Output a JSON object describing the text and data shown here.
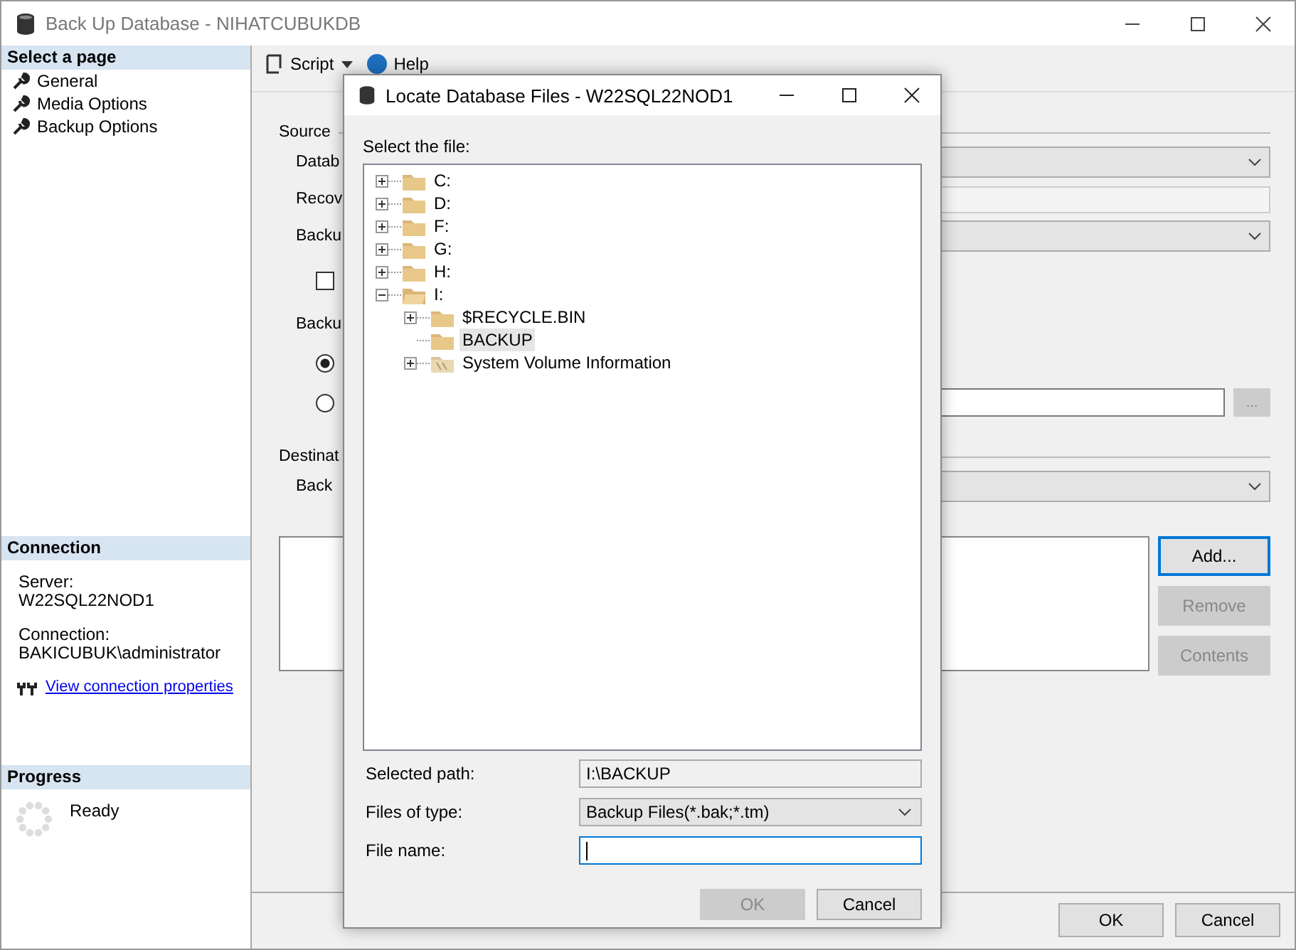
{
  "window": {
    "title": "Back Up Database - NIHATCUBUKDB"
  },
  "sidebar": {
    "header": "Select a page",
    "pages": [
      "General",
      "Media Options",
      "Backup Options"
    ]
  },
  "connection": {
    "header": "Connection",
    "server_label": "Server:",
    "server": "W22SQL22NOD1",
    "connection_label": "Connection:",
    "connection": "BAKICUBUK\\administrator",
    "link": "View connection properties"
  },
  "progress": {
    "header": "Progress",
    "status": "Ready"
  },
  "toolbar": {
    "script": "Script",
    "help": "Help"
  },
  "form": {
    "source_label": "Source",
    "database_label": "Datab",
    "recovery_label": "Recov",
    "backup_type_label": "Backu",
    "copy_only_checked": false,
    "component_label": "Backu",
    "radios": [
      {
        "selected": true
      },
      {
        "selected": false
      }
    ],
    "browse_button": "...",
    "destination_label": "Destinat",
    "back_to_label": "Back",
    "buttons": [
      {
        "label": "Add...",
        "disabled": false,
        "focused": true
      },
      {
        "label": "Remove",
        "disabled": true,
        "focused": false
      },
      {
        "label": "Contents",
        "disabled": true,
        "focused": false
      }
    ]
  },
  "footer": {
    "buttons": [
      "OK",
      "Cancel"
    ]
  },
  "dialog": {
    "title": "Locate Database Files - W22SQL22NOD1",
    "prompt": "Select the file:",
    "tree": [
      {
        "label": "C:",
        "expandable": true,
        "expanded": false,
        "kind": "folder",
        "selected": false
      },
      {
        "label": "D:",
        "expandable": true,
        "expanded": false,
        "kind": "folder",
        "selected": false
      },
      {
        "label": "F:",
        "expandable": true,
        "expanded": false,
        "kind": "folder",
        "selected": false
      },
      {
        "label": "G:",
        "expandable": true,
        "expanded": false,
        "kind": "folder",
        "selected": false
      },
      {
        "label": "H:",
        "expandable": true,
        "expanded": false,
        "kind": "folder",
        "selected": false
      },
      {
        "label": "I:",
        "expandable": true,
        "expanded": true,
        "kind": "folder",
        "selected": false,
        "children": [
          {
            "label": "$RECYCLE.BIN",
            "expandable": true,
            "expanded": false,
            "kind": "folder",
            "selected": false
          },
          {
            "label": "BACKUP",
            "expandable": false,
            "kind": "folder",
            "selected": true
          },
          {
            "label": "System Volume Information",
            "expandable": true,
            "expanded": false,
            "kind": "system",
            "selected": false
          }
        ]
      }
    ],
    "selected_path_label": "Selected path:",
    "selected_path": "I:\\BACKUP",
    "type_label": "Files of type:",
    "type_value": "Backup Files(*.bak;*.tm)",
    "name_label": "File name:",
    "name_focused": true,
    "buttons": [
      {
        "label": "OK",
        "disabled": true
      },
      {
        "label": "Cancel",
        "disabled": false
      }
    ]
  }
}
